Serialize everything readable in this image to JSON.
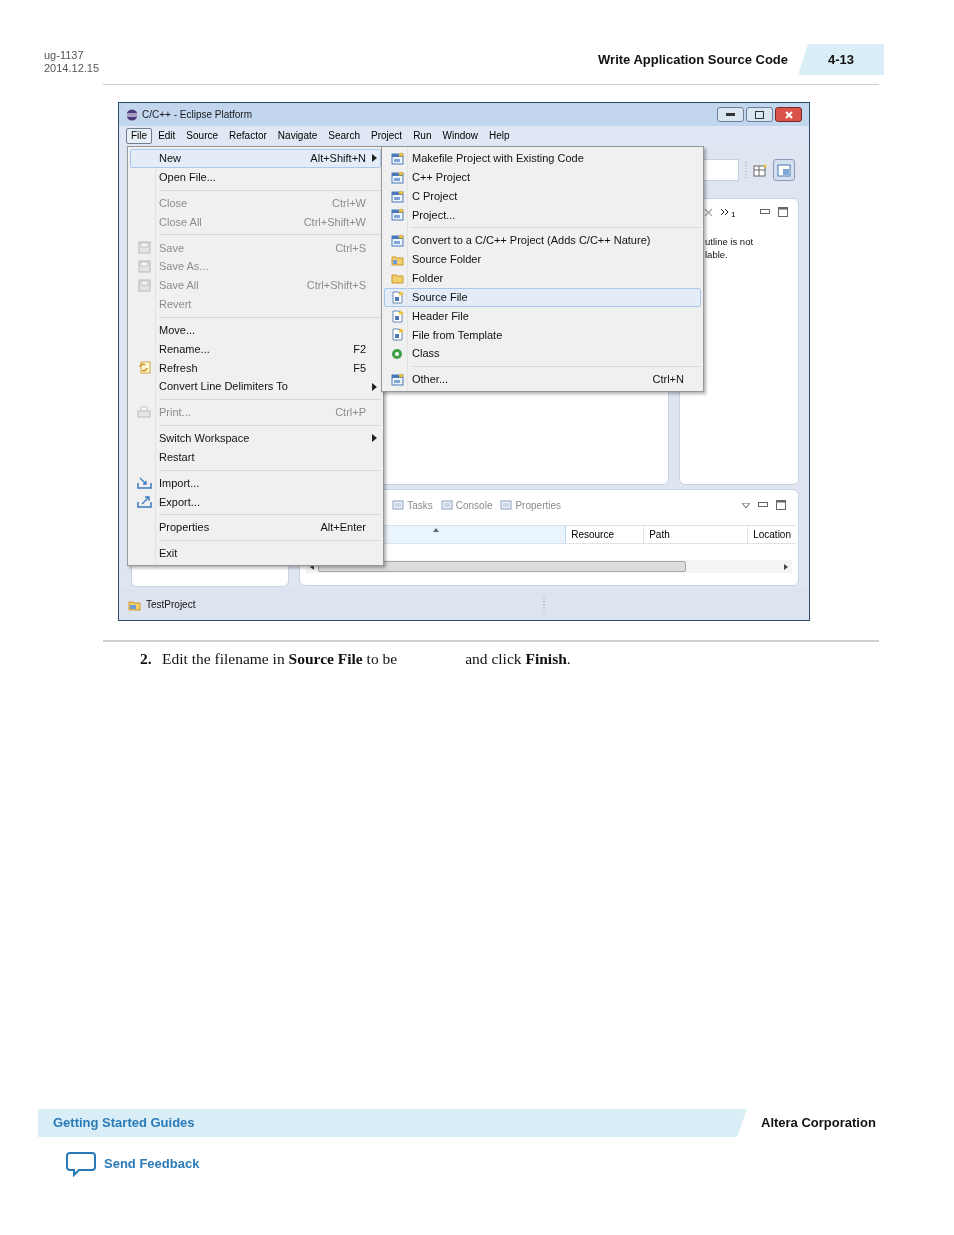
{
  "header": {
    "doc_id": "ug-1137",
    "date": "2014.12.15",
    "section_title": "Write Application Source Code",
    "page_number": "4-13"
  },
  "window": {
    "title": "C/C++ - Eclipse Platform",
    "menu_bar": [
      {
        "label": "File",
        "selected": true
      },
      {
        "label": "Edit",
        "selected": false
      },
      {
        "label": "Source",
        "selected": false
      },
      {
        "label": "Refactor",
        "selected": false
      },
      {
        "label": "Navigate",
        "selected": false
      },
      {
        "label": "Search",
        "selected": false
      },
      {
        "label": "Project",
        "selected": false
      },
      {
        "label": "Run",
        "selected": false
      },
      {
        "label": "Window",
        "selected": false
      },
      {
        "label": "Help",
        "selected": false
      }
    ],
    "file_menu": [
      [
        {
          "label": "New",
          "shortcut": "Alt+Shift+N",
          "submenu": true,
          "disabled": false,
          "selected": true
        },
        {
          "label": "Open File...",
          "submenu": false,
          "disabled": false,
          "selected": false
        }
      ],
      [
        {
          "label": "Close",
          "shortcut": "Ctrl+W",
          "submenu": false,
          "disabled": true,
          "selected": false
        },
        {
          "label": "Close All",
          "shortcut": "Ctrl+Shift+W",
          "submenu": false,
          "disabled": true,
          "selected": false
        }
      ],
      [
        {
          "label": "Save",
          "shortcut": "Ctrl+S",
          "submenu": false,
          "disabled": true,
          "selected": false
        },
        {
          "label": "Save As...",
          "submenu": false,
          "disabled": true,
          "selected": false
        },
        {
          "label": "Save All",
          "shortcut": "Ctrl+Shift+S",
          "submenu": false,
          "disabled": true,
          "selected": false
        },
        {
          "label": "Revert",
          "submenu": false,
          "disabled": true,
          "selected": false
        }
      ],
      [
        {
          "label": "Move...",
          "submenu": false,
          "disabled": false,
          "selected": false
        },
        {
          "label": "Rename...",
          "shortcut": "F2",
          "submenu": false,
          "disabled": false,
          "selected": false
        },
        {
          "label": "Refresh",
          "shortcut": "F5",
          "submenu": false,
          "disabled": false,
          "selected": false
        },
        {
          "label": "Convert Line Delimiters To",
          "submenu": true,
          "disabled": false,
          "selected": false
        }
      ],
      [
        {
          "label": "Print...",
          "shortcut": "Ctrl+P",
          "submenu": false,
          "disabled": true,
          "selected": false
        }
      ],
      [
        {
          "label": "Switch Workspace",
          "submenu": true,
          "disabled": false,
          "selected": false
        },
        {
          "label": "Restart",
          "submenu": false,
          "disabled": false,
          "selected": false
        }
      ],
      [
        {
          "label": "Import...",
          "submenu": false,
          "disabled": false,
          "selected": false
        },
        {
          "label": "Export...",
          "submenu": false,
          "disabled": false,
          "selected": false
        }
      ],
      [
        {
          "label": "Properties",
          "shortcut": "Alt+Enter",
          "submenu": false,
          "disabled": false,
          "selected": false
        }
      ],
      [
        {
          "label": "Exit",
          "submenu": false,
          "disabled": false,
          "selected": false
        }
      ]
    ],
    "new_submenu": [
      [
        {
          "label": "Makefile Project with Existing Code",
          "selected": false
        },
        {
          "label": "C++ Project",
          "selected": false
        },
        {
          "label": "C Project",
          "selected": false
        },
        {
          "label": "Project...",
          "selected": false
        }
      ],
      [
        {
          "label": "Convert to a C/C++ Project (Adds C/C++ Nature)",
          "selected": false
        },
        {
          "label": "Source Folder",
          "selected": false
        },
        {
          "label": "Folder",
          "selected": false
        },
        {
          "label": "Source File",
          "selected": true
        },
        {
          "label": "Header File",
          "selected": false
        },
        {
          "label": "File from Template",
          "selected": false
        },
        {
          "label": "Class",
          "selected": false
        }
      ],
      [
        {
          "label": "Other...",
          "shortcut": "Ctrl+N",
          "selected": false
        }
      ]
    ],
    "outline_tab_count": "1",
    "outline_message": [
      "utline is not",
      "lable."
    ],
    "bottom_tabs": [
      "Tasks",
      "Console",
      "Properties"
    ],
    "table_columns": [
      "Resource",
      "Path",
      "Location"
    ],
    "status": "TestProject"
  },
  "step": {
    "number": "2.",
    "text_before": "Edit the filename in **Source File** to be",
    "text_after": "and click **Finish**."
  },
  "footer": {
    "guide": "Getting Started Guides",
    "company": "Altera Corporation",
    "feedback": "Send Feedback"
  }
}
